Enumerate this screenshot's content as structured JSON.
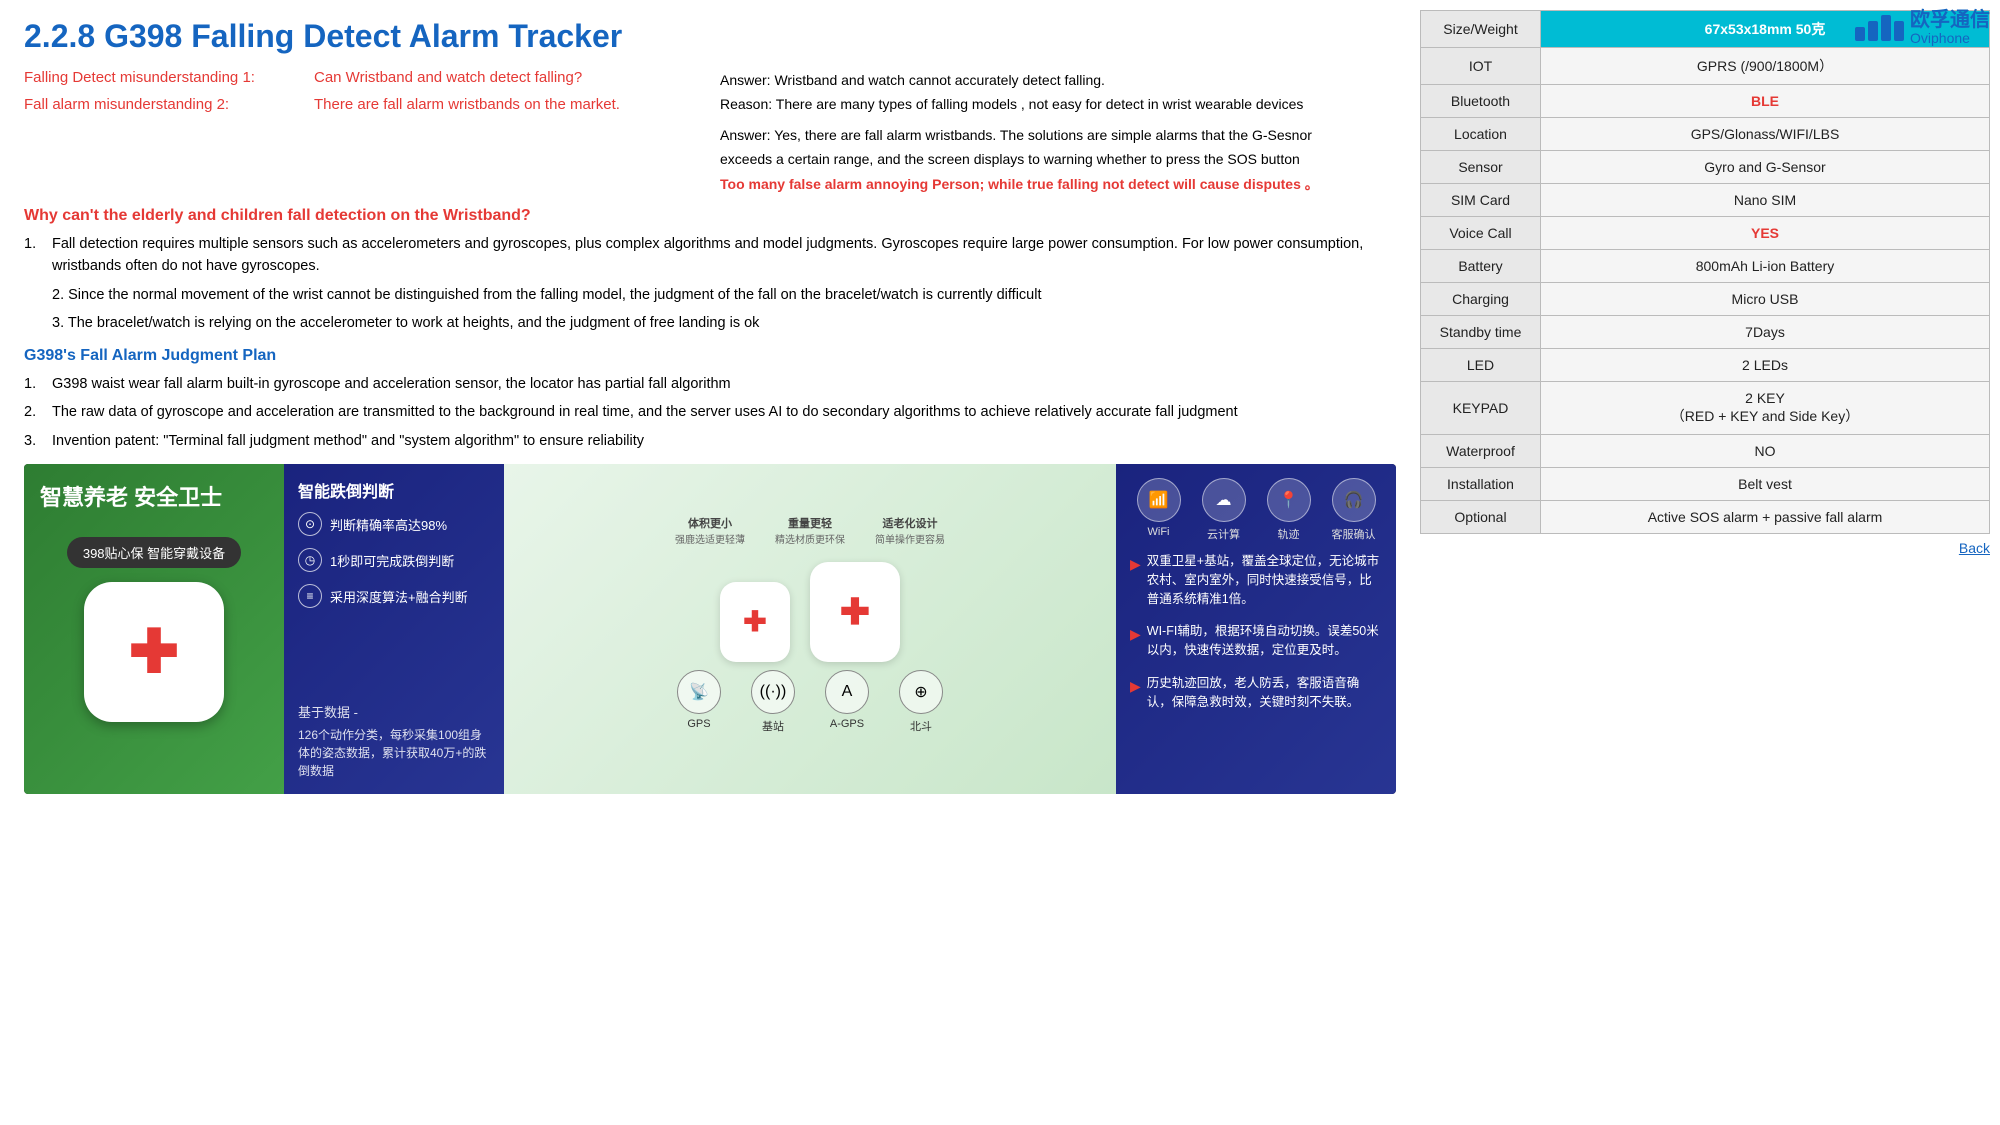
{
  "logo": {
    "text": "欧孚通信",
    "subtext": "Oviphone"
  },
  "header": {
    "title": "2.2.8  G398  Falling Detect Alarm Tracker"
  },
  "misunderstandings": [
    {
      "label": "Falling Detect misunderstanding 1:",
      "question": "Can Wristband and watch detect falling?",
      "answer_line1": "Answer: Wristband and watch cannot accurately detect falling.",
      "answer_line2": "Reason: There are many types of falling models , not easy for detect in wrist wearable devices"
    },
    {
      "label": "Fall alarm misunderstanding 2:",
      "question": "There are fall alarm wristbands on the market.",
      "answer_line1": "Answer: Yes, there are fall alarm wristbands. The solutions are simple alarms that the G-Sesnor",
      "answer_line2": "exceeds a certain range, and the screen displays to warning whether to press the SOS button",
      "answer_line3": "Too many false alarm  annoying Person; while true falling not detect will cause disputes 。",
      "answer_bold": true
    }
  ],
  "why_heading": "Why can't the elderly and children fall detection on the Wristband?",
  "why_reasons": [
    {
      "num": "1.",
      "text": "Fall detection requires multiple sensors such as accelerometers and gyroscopes, plus complex algorithms and model judgments. Gyroscopes require large power consumption. For low power consumption, wristbands often do not have gyroscopes."
    },
    {
      "num": "2.",
      "text": "2. Since the normal movement of the wrist cannot be distinguished from the falling model, the judgment of the fall on the bracelet/watch is currently difficult"
    },
    {
      "num": "3.",
      "text": "3. The bracelet/watch is relying on the accelerometer to work at heights, and the judgment of free landing is ok"
    }
  ],
  "g398_heading": "G398's Fall Alarm Judgment Plan",
  "g398_plans": [
    {
      "num": "1.",
      "text": "G398 waist wear fall alarm built-in gyroscope and acceleration sensor, the locator has partial fall algorithm"
    },
    {
      "num": "2.",
      "text": "The raw data of gyroscope and acceleration are transmitted to the background in real time, and the server uses AI to do secondary algorithms to achieve relatively accurate fall judgment"
    },
    {
      "num": "3.",
      "text": "Invention patent: \"Terminal fall judgment method\" and \"system algorithm\" to ensure reliability"
    }
  ],
  "image_panels": {
    "panel1": {
      "title_cn": "智慧养老 安全卫士",
      "badge": "398贴心保 智能穿戴设备"
    },
    "panel2": {
      "title": "智能跌倒判断",
      "items": [
        {
          "icon": "⊙",
          "text": "判断精确率高达98%"
        },
        {
          "icon": "◷",
          "text": "1秒即可完成跌倒判断"
        },
        {
          "icon": "≡",
          "text": "采用深度算法+融合判断"
        }
      ],
      "bottom_label": "基于数据 -",
      "bottom_text": "126个动作分类，每秒采集100组身体的姿态数据，累计获取40万+的跌倒数据"
    },
    "panel3": {
      "icons": [
        {
          "symbol": "◎",
          "label": "GPS"
        },
        {
          "symbol": "((·))",
          "label": "基站"
        },
        {
          "symbol": "A",
          "label": "A-GPS"
        },
        {
          "symbol": "⊕",
          "label": "北斗"
        }
      ],
      "features": [
        {
          "label": "体积更小",
          "sub": "强鹿选适更轻薄"
        },
        {
          "label": "重量更轻",
          "sub": "精选材质更环保"
        },
        {
          "label": "适老化设计",
          "sub": "简单操作更容易"
        }
      ]
    },
    "panel4": {
      "items": [
        {
          "text": "双重卫星+基站，覆盖全球定位，无论城市农村、室内室外，同时快速接受信号，比普通系统精准1倍。"
        },
        {
          "text": "WI-FI辅助，根据环境自动切换。误差50米以内，快速传送数据，定位更及时。"
        },
        {
          "text": "历史轨迹回放，老人防丢，客服语音确认，保障急救时效，关键时刻不失联。"
        }
      ]
    }
  },
  "specs": {
    "rows": [
      {
        "label": "Size/Weight",
        "value": "67x53x18mm 50克",
        "highlight": true
      },
      {
        "label": "IOT",
        "value": "GPRS (/900/1800M）"
      },
      {
        "label": "Bluetooth",
        "value": "BLE",
        "red": true
      },
      {
        "label": "Location",
        "value": "GPS/Glonass/WIFI/LBS"
      },
      {
        "label": "Sensor",
        "value": "Gyro and G-Sensor"
      },
      {
        "label": "SIM Card",
        "value": "Nano SIM"
      },
      {
        "label": "Voice Call",
        "value": "YES",
        "red": true
      },
      {
        "label": "Battery",
        "value": "800mAh Li-ion Battery"
      },
      {
        "label": "Charging",
        "value": "Micro USB"
      },
      {
        "label": "Standby time",
        "value": "7Days"
      },
      {
        "label": "LED",
        "value": "2     LEDs"
      },
      {
        "label": "KEYPAD",
        "value": "2 KEY\n（RED + KEY and Side Key）"
      },
      {
        "label": "Waterproof",
        "value": "NO"
      },
      {
        "label": "Installation",
        "value": "Belt vest"
      },
      {
        "label": "Optional",
        "value": "Active SOS alarm + passive fall alarm"
      }
    ]
  },
  "back_link": "Back"
}
